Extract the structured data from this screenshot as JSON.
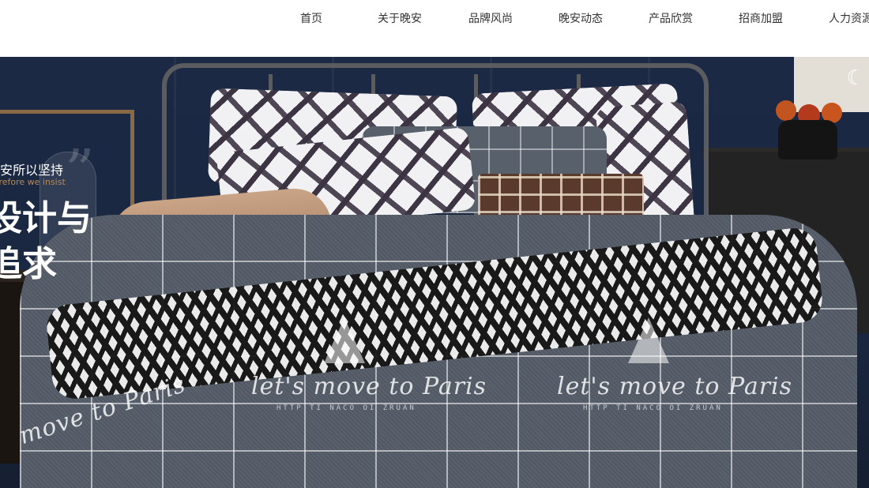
{
  "nav": {
    "items": [
      {
        "label": "首页"
      },
      {
        "label": "关于晚安"
      },
      {
        "label": "品牌风尚"
      },
      {
        "label": "晚安动态"
      },
      {
        "label": "产品欣赏"
      },
      {
        "label": "招商加盟"
      },
      {
        "label": "人力资源"
      }
    ]
  },
  "hero": {
    "slogan_small": "晚安所以坚持",
    "slogan_en": "Therefore we insist",
    "slogan_big_line1": "设计与",
    "slogan_big_line2": "追求",
    "bed_print_left": "let's move to Paris",
    "bed_print_right": "let's move to Paris",
    "bed_print_edge": "move to Paris",
    "bed_sub": "HTTP   TI NACO   OI   ZRUAN",
    "brand_icon": "moon-icon"
  }
}
